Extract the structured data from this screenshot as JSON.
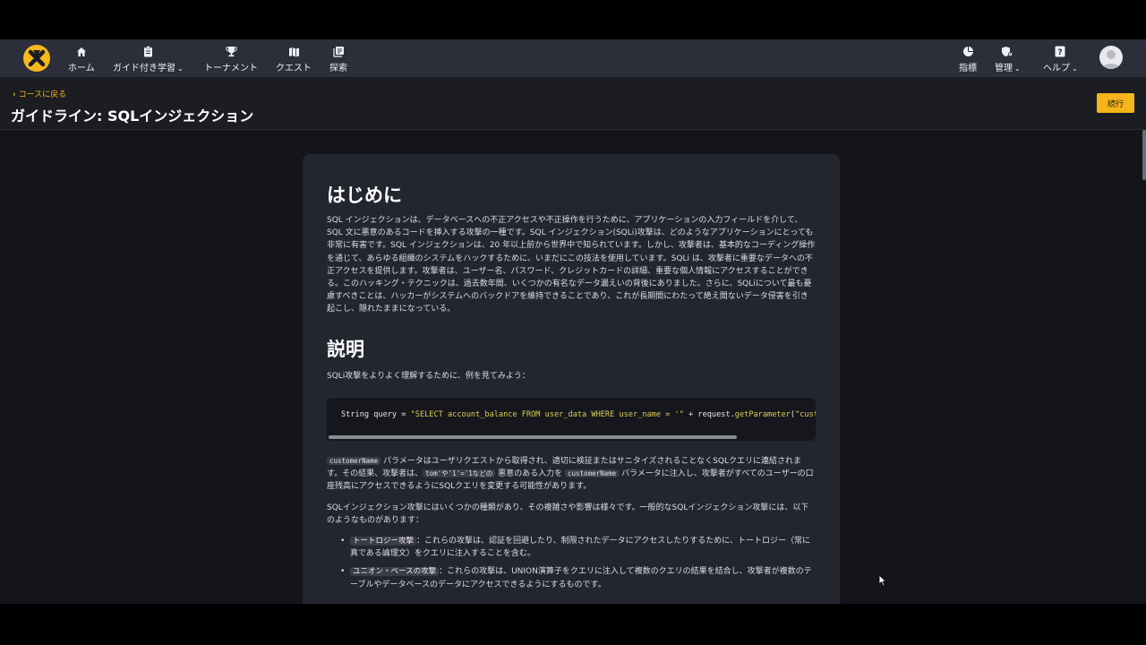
{
  "nav": {
    "items": [
      {
        "label": "ホーム",
        "icon": "home-icon"
      },
      {
        "label": "ガイド付き学習",
        "icon": "clipboard-icon"
      },
      {
        "label": "トーナメント",
        "icon": "trophy-icon"
      },
      {
        "label": "クエスト",
        "icon": "map-icon"
      },
      {
        "label": "探索",
        "icon": "explore-icon"
      }
    ],
    "right_items": [
      {
        "label": "指標",
        "icon": "pie-chart-icon"
      },
      {
        "label": "管理",
        "icon": "shield-gear-icon"
      },
      {
        "label": "ヘルプ",
        "icon": "question-icon"
      }
    ]
  },
  "subheader": {
    "back_label": "コースに戻る",
    "title": "ガイドライン: SQLインジェクション",
    "continue_label": "続行"
  },
  "article": {
    "intro_heading": "はじめに",
    "intro_text": "SQL インジェクションは、データベースへの不正アクセスや不正操作を行うために、アプリケーションの入力フィールドを介して、SQL 文に悪意のあるコードを挿入する攻撃の一種です。SQL インジェクション(SQLi)攻撃は、どのようなアプリケーションにとっても非常に有害です。SQL インジェクションは、20 年以上前から世界中で知られています。しかし、攻撃者は、基本的なコーディング操作を通じて、あらゆる組織のシステムをハックするために、いまだにこの技法を使用しています。SQLi は、攻撃者に重要なデータへの不正アクセスを提供します。攻撃者は、ユーザー名、パスワード、クレジットカードの詳細、重要な個人情報にアクセスすることができる。このハッキング・テクニックは、過去数年間、いくつかの有名なデータ漏えいの背後にありました。さらに、SQLiについて最も憂慮すべきことは、ハッカーがシステムへのバックドアを維持できることであり、これが長期間にわたって絶え間ないデータ侵害を引き起こし、隠れたままになっている。",
    "explain_heading": "説明",
    "explain_text": "SQLi攻撃をよりよく理解するために、例を見てみよう：",
    "code": {
      "p1": "String query = ",
      "p2": "\"SELECT account_balance FROM user_data WHERE user_name = '\"",
      "p3": " + request.",
      "p4": "getParameter",
      "p5": "(",
      "p6": "\"cust"
    },
    "para2": {
      "code1": "customerName",
      "t1": " パラメータはユーザリクエストから取得され、適切に検証またはサニタイズされることなくSQLクエリに連結されます。その結果、攻撃者は、",
      "code2": "tom'や'1'='1などの",
      "t2": " 悪意のある入力を ",
      "code3": "customerName",
      "t3": " パラメータに注入し、攻撃者がすべてのユーザーの口座残高にアクセスできるようにSQLクエリを変更する可能性があります。"
    },
    "para3": "SQLインジェクション攻撃にはいくつかの種類があり、その複雑さや影響は様々です。一般的なSQLインジェクション攻撃には、以下のようなものがあります：",
    "list": [
      {
        "term": "トートロジー攻撃",
        "text": "：これらの攻撃は、認証を回避したり、制限されたデータにアクセスしたりするために、トートロジー（常に真である論理文）をクエリに注入することを含む。"
      },
      {
        "term": "ユニオン・ベースの攻撃",
        "text": "：これらの攻撃は、UNION演算子をクエリに注入して複数のクエリの結果を結合し、攻撃者が複数のテーブルやデータベースのデータにアクセスできるようにするものです。"
      }
    ]
  }
}
